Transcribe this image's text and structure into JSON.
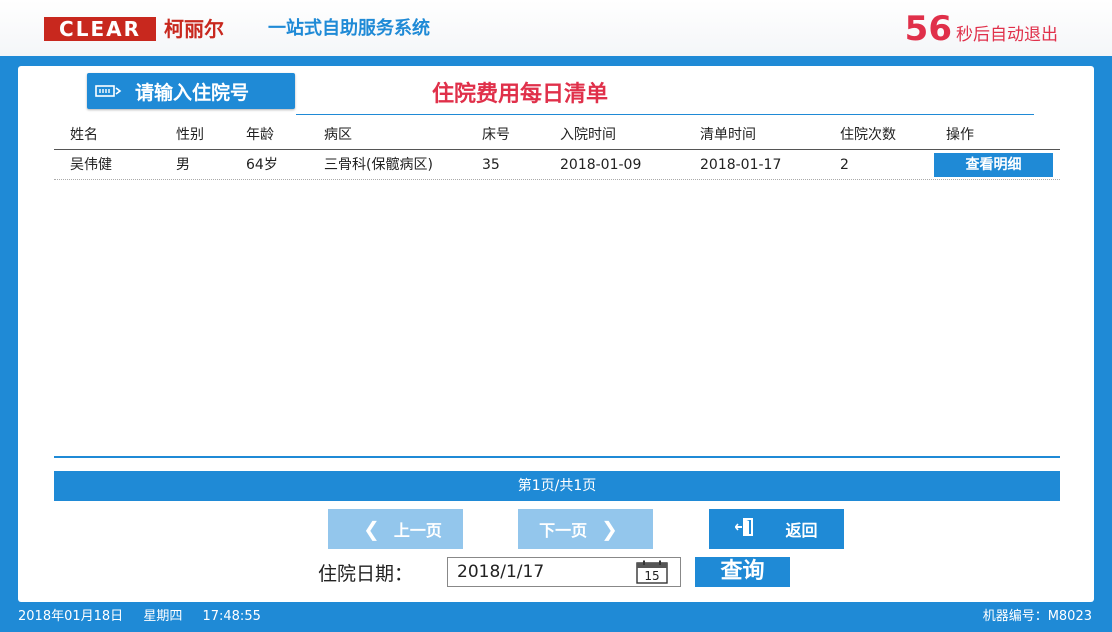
{
  "header": {
    "logo_text": "CLEAR",
    "brand_cn": "柯丽尔",
    "system_name": "一站式自助服务系统",
    "countdown_seconds": "56",
    "countdown_text": "秒后自动退出"
  },
  "toolbar": {
    "input_label": "请输入住院号",
    "page_title": "住院费用每日清单"
  },
  "table": {
    "headers": [
      "姓名",
      "性别",
      "年龄",
      "病区",
      "床号",
      "入院时间",
      "清单时间",
      "住院次数",
      "操作"
    ],
    "rows": [
      {
        "name": "吴伟健",
        "gender": "男",
        "age": "64岁",
        "ward": "三骨科(保髋病区)",
        "bed": "35",
        "admit_date": "2018-01-09",
        "list_date": "2018-01-17",
        "times": "2",
        "action_label": "查看明细"
      }
    ]
  },
  "pager": {
    "text": "第1页/共1页",
    "prev_label": "上一页",
    "next_label": "下一页",
    "back_label": "返回"
  },
  "query": {
    "date_label": "住院日期：",
    "date_value": "2018/1/17",
    "calendar_day": "15",
    "query_label": "查询"
  },
  "status": {
    "date": "2018年01月18日",
    "weekday": "星期四",
    "time": "17:48:55",
    "machine": "机器编号：M8023"
  },
  "colors": {
    "primary": "#1f8ad6",
    "accent_red": "#e0304a",
    "logo_red": "#c8281e",
    "disabled_blue": "#93c6ec"
  }
}
